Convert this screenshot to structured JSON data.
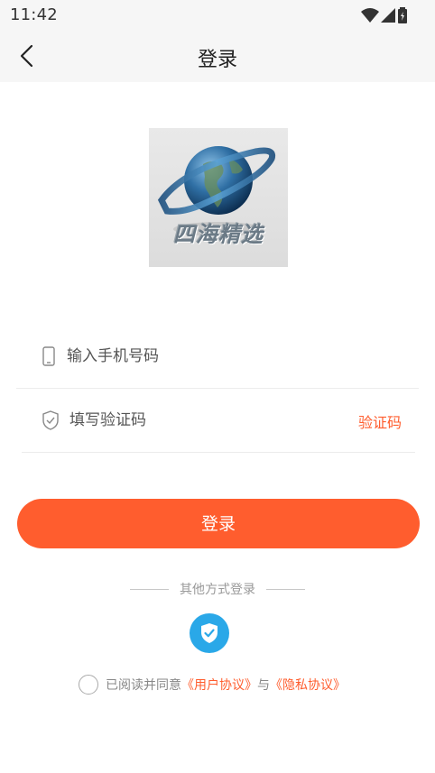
{
  "status_bar": {
    "time": "11:42",
    "icons": [
      "wifi-icon",
      "signal-icon",
      "battery-icon"
    ]
  },
  "header": {
    "title": "登录",
    "back_icon": "back-arrow-icon"
  },
  "logo": {
    "text": "四海精选"
  },
  "form": {
    "phone_placeholder": "输入手机号码",
    "phone_value": "",
    "code_placeholder": "填写验证码",
    "code_value": "",
    "code_link": "验证码"
  },
  "login_button": "登录",
  "other_login": {
    "label": "其他方式登录",
    "options": [
      "shield-check-icon"
    ]
  },
  "agreement": {
    "prefix": "已阅读并同意",
    "user_agreement": "《用户协议》",
    "connector": "与",
    "privacy_agreement": "《隐私协议》"
  },
  "colors": {
    "accent": "#ff5d2e",
    "shield": "#2aa8e8",
    "header_bg": "#f6f6f6"
  }
}
